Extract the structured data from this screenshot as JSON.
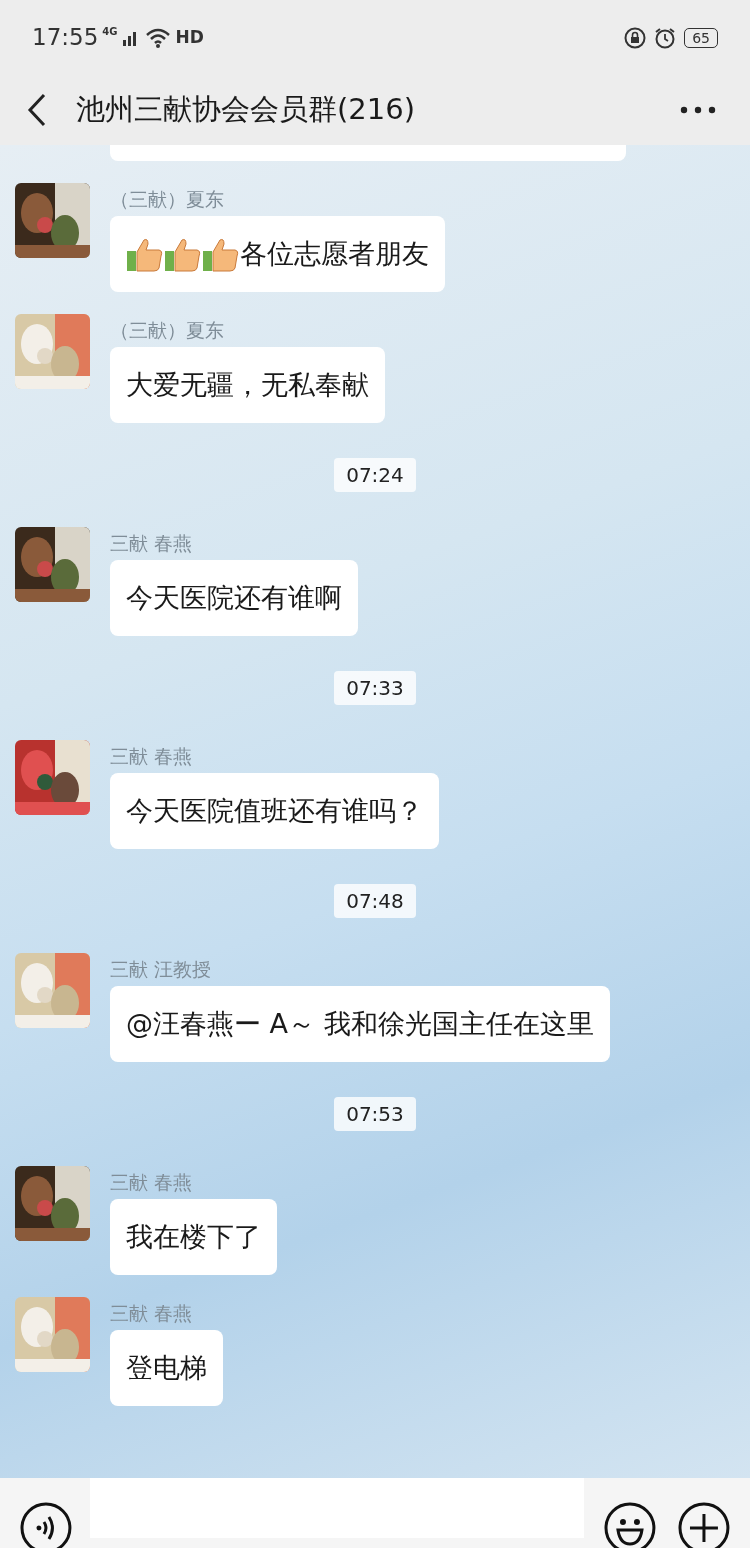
{
  "status_bar": {
    "time": "17:55",
    "network": "4G",
    "hd": "HD",
    "battery": "65"
  },
  "header": {
    "title": "池州三献协会会员群(216)"
  },
  "chat": [
    {
      "kind": "message",
      "sender": "（三献）夏东",
      "icons": [
        {
          "kind": "thumbs_up"
        },
        {
          "kind": "thumbs_up"
        },
        {
          "kind": "thumbs_up"
        }
      ],
      "text": "各位志愿者朋友"
    },
    {
      "kind": "message",
      "sender": "（三献）夏东",
      "text": "大爱无疆，无私奉献"
    },
    {
      "kind": "time",
      "text": "07:24"
    },
    {
      "kind": "message",
      "sender": "三献 春燕",
      "text": "今天医院还有谁啊"
    },
    {
      "kind": "time",
      "text": "07:33"
    },
    {
      "kind": "message",
      "sender": "三献 春燕",
      "text": "今天医院值班还有谁吗？"
    },
    {
      "kind": "time",
      "text": "07:48"
    },
    {
      "kind": "message",
      "sender": "三献 汪教授",
      "text": "@汪春燕ー A～  我和徐光国主任在这里"
    },
    {
      "kind": "time",
      "text": "07:53"
    },
    {
      "kind": "message",
      "sender": "三献 春燕",
      "text": "我在楼下了"
    },
    {
      "kind": "message",
      "sender": "三献 春燕",
      "text": "登电梯"
    }
  ]
}
